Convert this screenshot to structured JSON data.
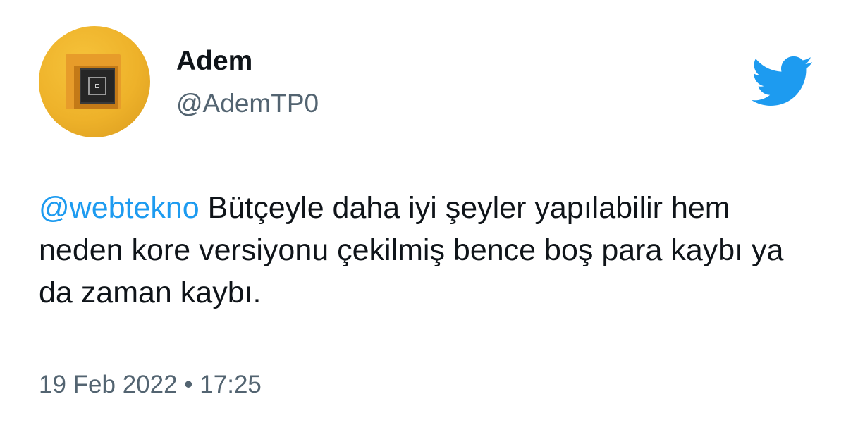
{
  "tweet": {
    "author": {
      "display_name": "Adem",
      "handle": "@AdemTP0",
      "avatar": "avatar-nested-squares"
    },
    "logo_icon": "twitter-bird-icon",
    "text": {
      "mention": "@webtekno",
      "body": " Bütçeyle daha iyi şeyler yapılabilir hem neden kore versiyonu çekilmiş bence boş para kaybı ya da zaman kaybı."
    },
    "date": "19 Feb 2022",
    "separator": "•",
    "time": "17:25"
  },
  "colors": {
    "link": "#1d9bf0",
    "text": "#0f1419",
    "secondary": "#536471",
    "avatar_bg": "#eeb22a"
  }
}
